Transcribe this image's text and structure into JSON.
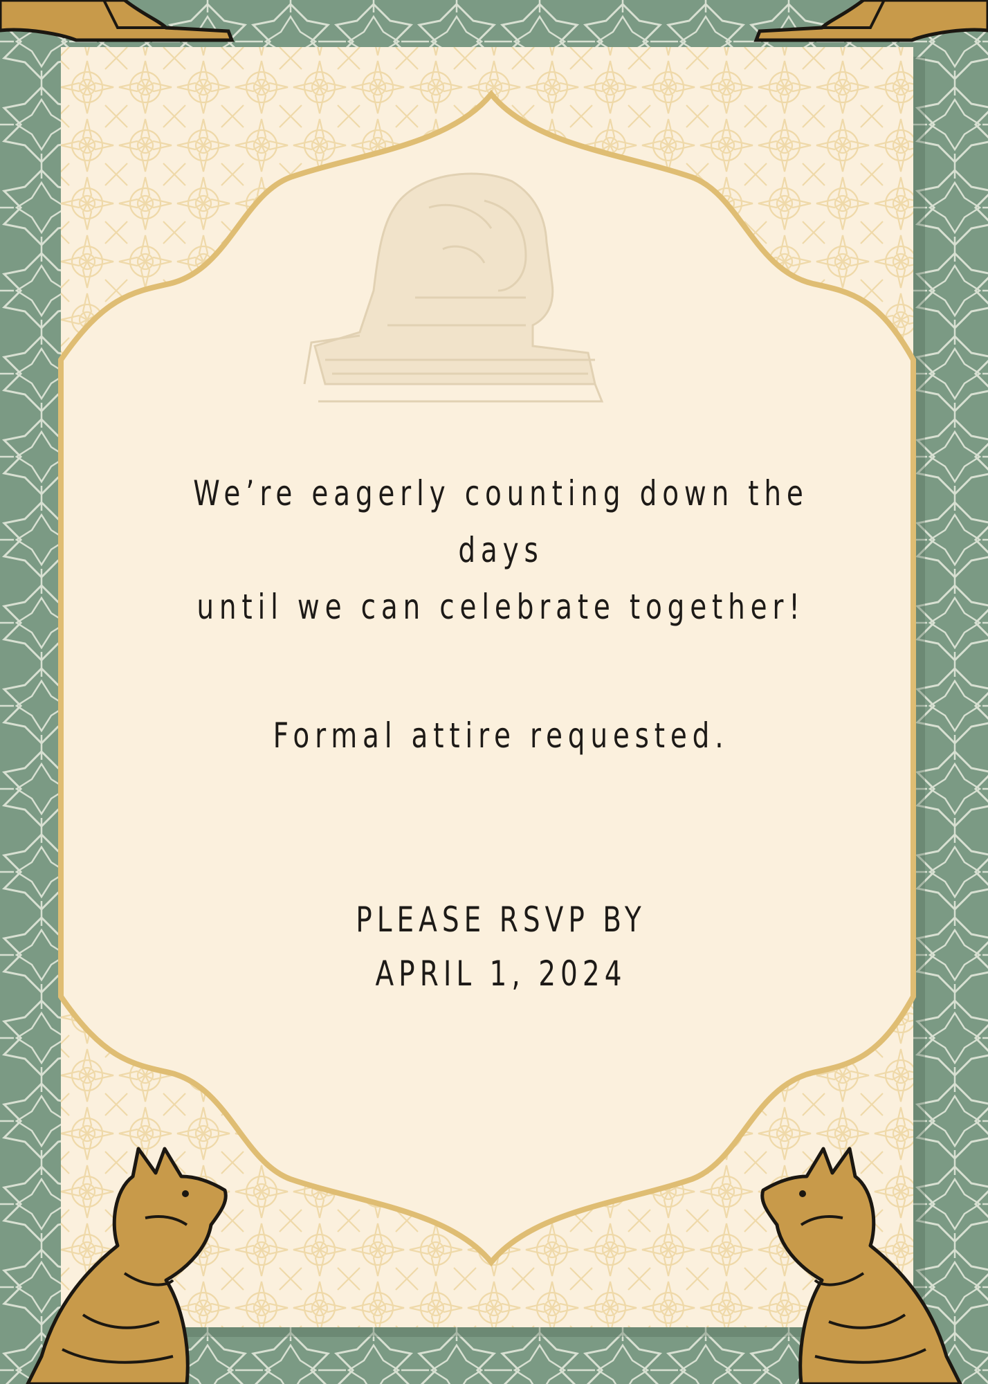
{
  "colors": {
    "background_green": "#7b9a84",
    "pattern_green": "#d9dfcf",
    "card_cream": "#fbf0dd",
    "frame_gold": "#dfbd73",
    "pattern_gold": "#efd9a9",
    "text_dark": "#1d1a17",
    "cat_gold": "#c89a4a",
    "ink": "#1b1711"
  },
  "icons": [
    "sphinx-illustration",
    "cat-statue-left",
    "cat-statue-right",
    "bird-statue-top-left",
    "bird-statue-top-right"
  ],
  "message": {
    "line1": "We’re eagerly counting down the days",
    "line2": "until we can celebrate together!"
  },
  "attire": "Formal attire requested.",
  "rsvp": {
    "line1": "PLEASE RSVP BY",
    "line2": "APRIL 1, 2024"
  }
}
